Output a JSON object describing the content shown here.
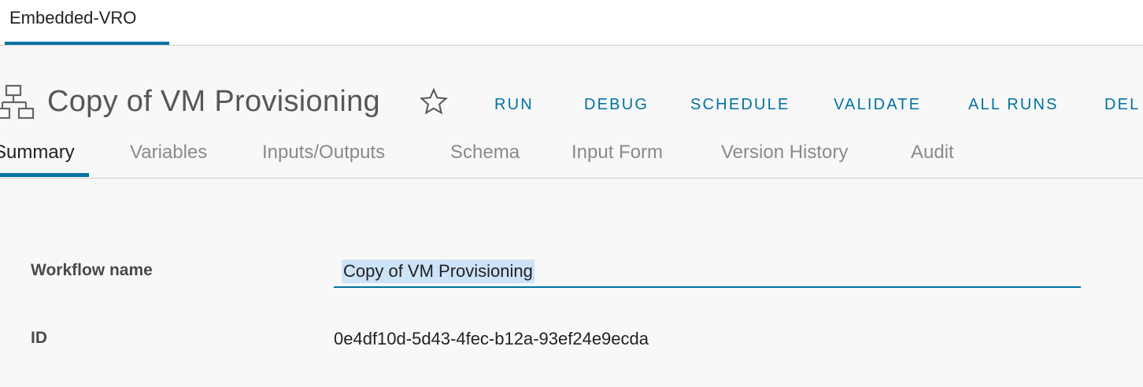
{
  "top_tab": {
    "label": "Embedded-VRO"
  },
  "header": {
    "title": "Copy of VM Provisioning",
    "actions": [
      "RUN",
      "DEBUG",
      "SCHEDULE",
      "VALIDATE",
      "ALL RUNS",
      "DEL"
    ]
  },
  "subtabs": [
    "Summary",
    "Variables",
    "Inputs/Outputs",
    "Schema",
    "Input Form",
    "Version History",
    "Audit"
  ],
  "summary": {
    "workflow_name_label": "Workflow name",
    "workflow_name_value": "Copy of VM Provisioning",
    "id_label": "ID",
    "id_value": "0e4df10d-5d43-4fec-b12a-93ef24e9ecda"
  },
  "colors": {
    "accent": "#0072a3",
    "selection": "#cde3f7",
    "background": "#f8f8f8"
  },
  "icons": [
    "workflow-icon",
    "star-icon"
  ]
}
